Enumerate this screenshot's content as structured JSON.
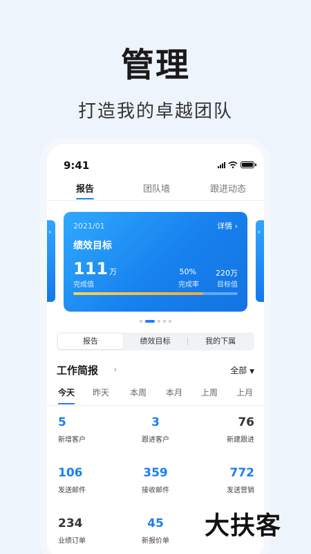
{
  "promo": {
    "title": "管理",
    "subtitle": "打造我的卓越团队"
  },
  "status_bar": {
    "time": "9:41",
    "icons": [
      "signal-icon",
      "wifi-icon",
      "battery-icon"
    ]
  },
  "top_tabs": [
    {
      "label": "报告",
      "active": true
    },
    {
      "label": "团队墙",
      "active": false
    },
    {
      "label": "跟进动态",
      "active": false
    }
  ],
  "card": {
    "date": "2021/01",
    "detail_label": "详情",
    "title": "绩效目标",
    "completed_value": "111",
    "completed_unit": "万",
    "completed_label": "完成值",
    "rate_value": "50%",
    "rate_label": "完成率",
    "target_value": "220万",
    "target_label": "目标值",
    "progress_fraction": 0.79,
    "accent": "#1c7fff"
  },
  "carousel": {
    "count": 5,
    "active_index": 1
  },
  "segment": [
    {
      "label": "报告",
      "active": true
    },
    {
      "label": "绩效目标",
      "active": false
    },
    {
      "label": "我的下属",
      "active": false
    }
  ],
  "brief": {
    "title": "工作简报",
    "filter_label": "全部"
  },
  "time_tabs": [
    {
      "label": "今天",
      "active": true
    },
    {
      "label": "昨天",
      "active": false
    },
    {
      "label": "本周",
      "active": false
    },
    {
      "label": "本月",
      "active": false
    },
    {
      "label": "上周",
      "active": false
    },
    {
      "label": "上月",
      "active": false
    }
  ],
  "metrics": [
    {
      "value": "5",
      "label": "新增客户",
      "color": "blue"
    },
    {
      "value": "3",
      "label": "跟进客户",
      "color": "blue"
    },
    {
      "value": "76",
      "label": "新建跟进",
      "color": "dark"
    },
    {
      "value": "106",
      "label": "发送邮件",
      "color": "blue"
    },
    {
      "value": "359",
      "label": "接收邮件",
      "color": "blue"
    },
    {
      "value": "772",
      "label": "发送营销",
      "color": "blue"
    },
    {
      "value": "234",
      "label": "业绩订单",
      "color": "dark"
    },
    {
      "value": "45",
      "label": "新报价单",
      "color": "blue"
    },
    {
      "value": "",
      "label": "",
      "color": "blue"
    }
  ],
  "watermark": "大扶客"
}
